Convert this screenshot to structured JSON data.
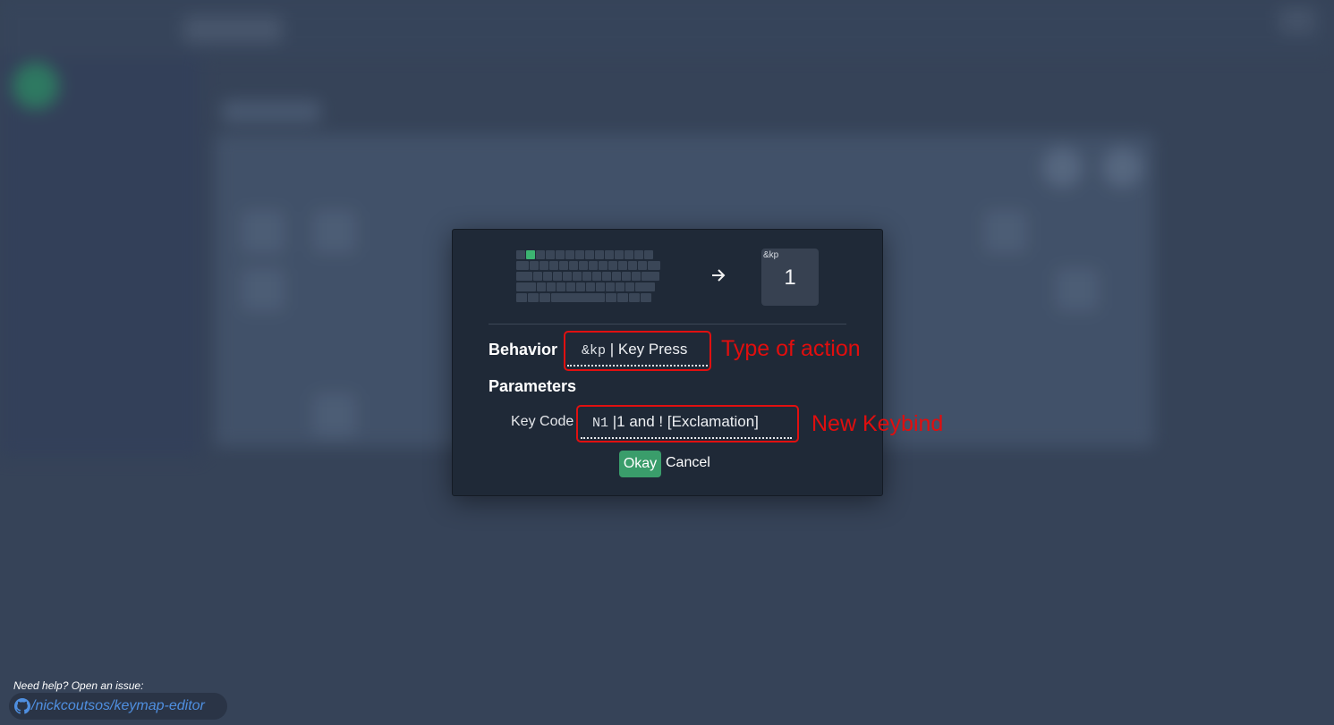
{
  "modal": {
    "key_card": {
      "behavior_tag": "&kp",
      "key_label": "1"
    },
    "behavior": {
      "label": "Behavior",
      "code": "&kp",
      "value": " | Key Press"
    },
    "parameters": {
      "label": "Parameters",
      "key_code_label": "Key Code",
      "code": "N1",
      "value": " |1 and ! [Exclamation]"
    },
    "buttons": {
      "okay": "Okay",
      "cancel": "Cancel"
    }
  },
  "annotations": {
    "type_of_action": "Type of action",
    "new_keybind": "New Keybind"
  },
  "footer": {
    "help_text": "Need help? Open an issue:",
    "repo_link": "/nickcoutsos/keymap-editor"
  },
  "colors": {
    "accent": "#3a9d6b",
    "highlight_key": "#3cb371",
    "annotation": "#e00e0e",
    "link": "#4f8fe0"
  },
  "icons": {
    "arrow": "arrow-right-icon",
    "github": "github-icon"
  }
}
